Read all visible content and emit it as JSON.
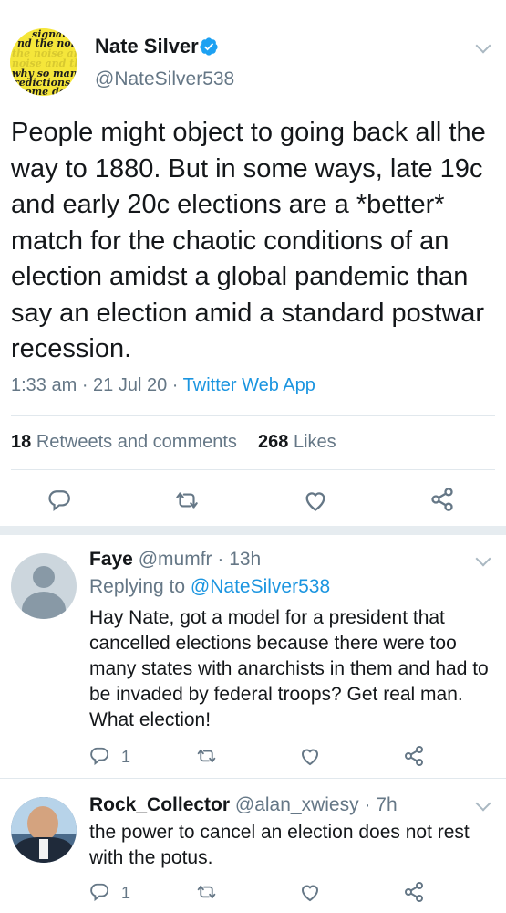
{
  "main_tweet": {
    "author_name": "Nate Silver",
    "handle": "@NateSilver538",
    "avatar_text": [
      "signal",
      "nd the noise",
      "the noise and th",
      "noise and the no",
      "why so many",
      "redictions fail",
      "some don"
    ],
    "text": "People might object to going back all the way to 1880. But in some ways, late 19c and early 20c elections are a *better* match for the chaotic conditions of an election amidst a global pandemic than say an election amid a standard postwar recession.",
    "time": "1:33 am",
    "date": "21 Jul 20",
    "source": "Twitter Web App",
    "retweets_count": "18",
    "retweets_label": "Retweets and comments",
    "likes_count": "268",
    "likes_label": "Likes"
  },
  "replies": [
    {
      "name": "Faye",
      "handle": "@mumfr",
      "time": "13h",
      "replying_to_label": "Replying to",
      "replying_to_handle": "@NateSilver538",
      "text": "Hay Nate, got a model for a president that cancelled elections because there were too many states with anarchists in them and had to be invaded by federal troops? Get real man. What election!",
      "reply_count": "1"
    },
    {
      "name": "Rock_Collector",
      "handle": "@alan_xwiesy",
      "time": "7h",
      "text": "the power to cancel an election does not rest with the potus.",
      "reply_count": "1"
    }
  ],
  "colors": {
    "accent": "#1b95e0",
    "muted": "#657786",
    "verified": "#1da1f2",
    "avatar_yellow": "#f5e63a"
  },
  "icons": [
    "reply-icon",
    "retweet-icon",
    "like-icon",
    "share-icon",
    "chevron-down-icon",
    "verified-badge-icon",
    "default-avatar-icon"
  ]
}
